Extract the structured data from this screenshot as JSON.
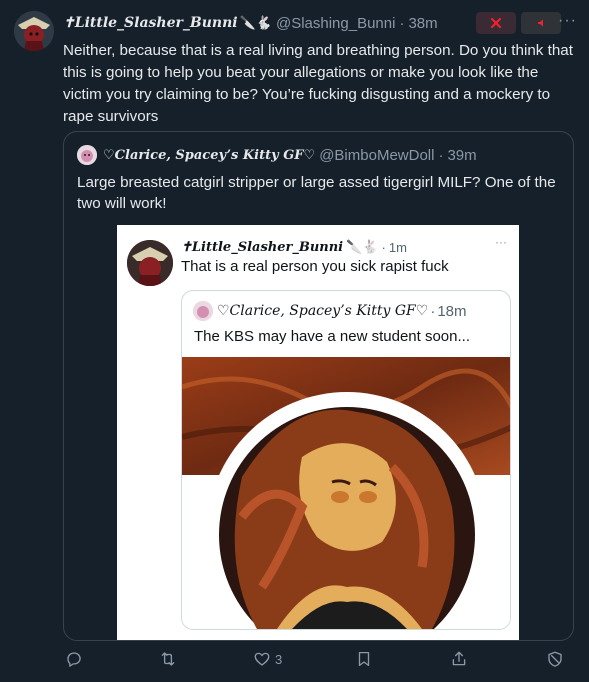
{
  "tweet": {
    "display_name": "✝Little_Slasher_Bunni",
    "emoji": "🔪🐇",
    "handle": "@Slashing_Bunni",
    "sep": "·",
    "time": "38m",
    "text": "Neither, because that is a real living and breathing person. Do you think that this is going to help you beat your allegations or make you look like the victim you try claiming to be? You’re fucking disgusting and a mockery to rape survivors"
  },
  "quote": {
    "display_name": "♡Clarice, Spacey’s Kitty GF♡",
    "handle": "@BimboMewDoll",
    "sep": "·",
    "time": "39m",
    "text": "Large breasted catgirl stripper or large assed tigergirl MILF?  One of the two will work!"
  },
  "screenshot": {
    "display_name": "✝Little_Slasher_Bunni",
    "emoji": "🔪🐇",
    "sep": "·",
    "time": "1m",
    "dots": "···",
    "text": "That is a real person you sick rapist fuck",
    "inner_quote": {
      "display_name": "♡Clarice, Spacey’s Kitty GF♡",
      "sep": "·",
      "time": "18m",
      "text": "The KBS may have a new student soon..."
    }
  },
  "actions": {
    "reply_count": "",
    "repost_count": "",
    "like_count": "3"
  },
  "colors": {
    "background": "#15202b",
    "text": "#e7e9ea",
    "secondary": "#8b98a5",
    "border": "#38444d"
  },
  "icons": [
    "close-icon",
    "mute-icon",
    "more-icon",
    "reply-icon",
    "repost-icon",
    "like-icon",
    "bookmark-icon",
    "share-icon",
    "block-icon"
  ]
}
